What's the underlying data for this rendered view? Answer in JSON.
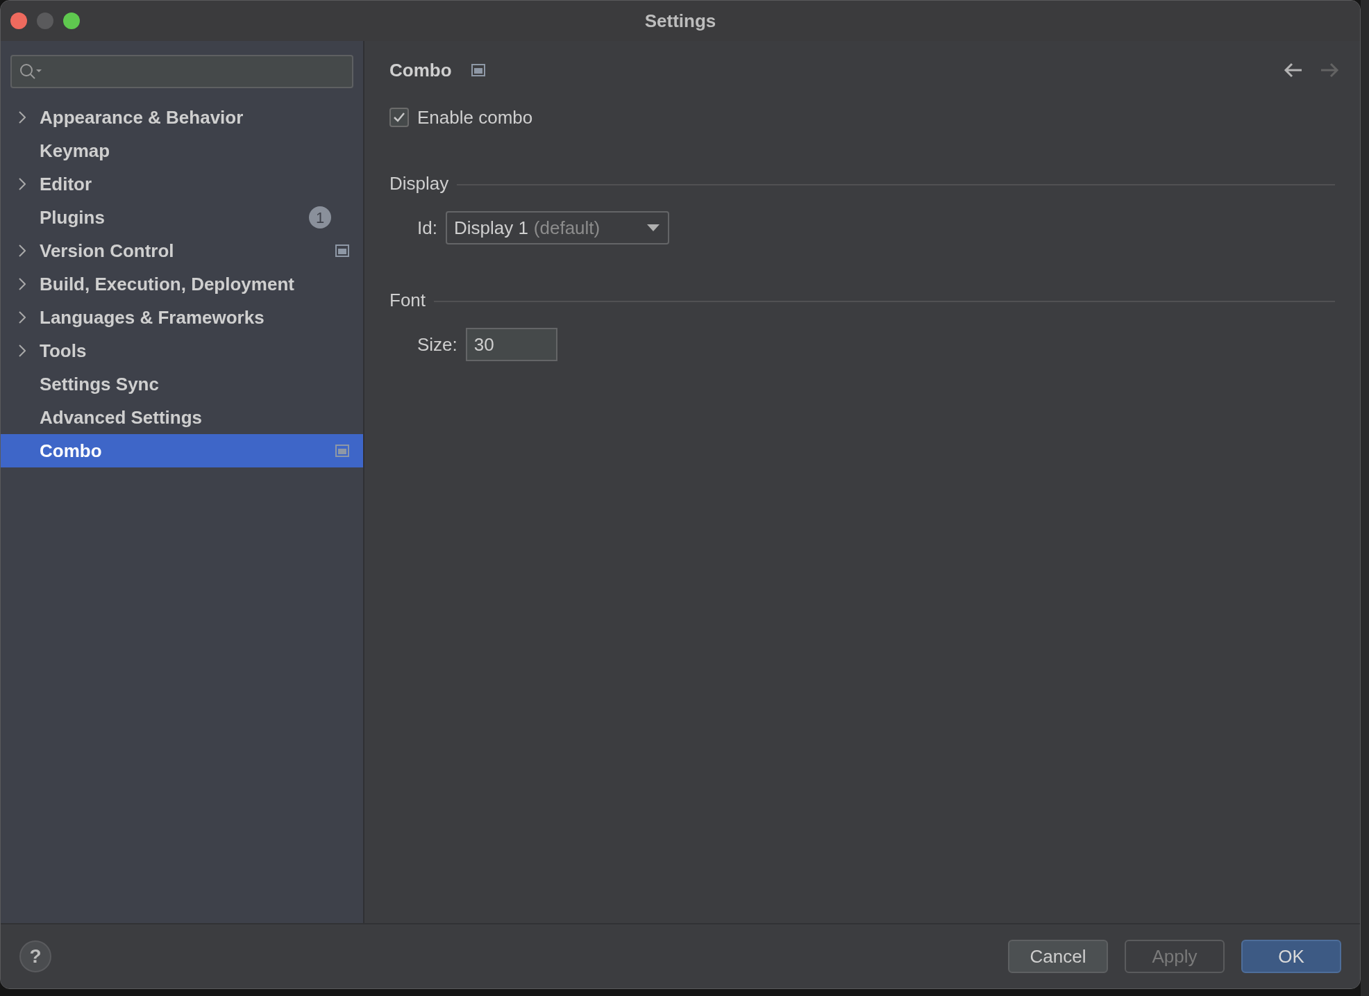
{
  "window": {
    "title": "Settings"
  },
  "sidebar": {
    "items": [
      {
        "label": "Appearance & Behavior",
        "expandable": true,
        "selected": false,
        "project_level": false
      },
      {
        "label": "Keymap",
        "expandable": false,
        "selected": false,
        "project_level": false
      },
      {
        "label": "Editor",
        "expandable": true,
        "selected": false,
        "project_level": false
      },
      {
        "label": "Plugins",
        "expandable": false,
        "selected": false,
        "project_level": false,
        "badge": "1"
      },
      {
        "label": "Version Control",
        "expandable": true,
        "selected": false,
        "project_level": true
      },
      {
        "label": "Build, Execution, Deployment",
        "expandable": true,
        "selected": false,
        "project_level": false
      },
      {
        "label": "Languages & Frameworks",
        "expandable": true,
        "selected": false,
        "project_level": false
      },
      {
        "label": "Tools",
        "expandable": true,
        "selected": false,
        "project_level": false
      },
      {
        "label": "Settings Sync",
        "expandable": false,
        "selected": false,
        "project_level": false
      },
      {
        "label": "Advanced Settings",
        "expandable": false,
        "selected": false,
        "project_level": false
      },
      {
        "label": "Combo",
        "expandable": false,
        "selected": true,
        "project_level": true
      }
    ]
  },
  "content": {
    "title": "Combo",
    "project_level": true,
    "enable": {
      "label": "Enable combo",
      "checked": true
    },
    "sections": [
      {
        "title": "Display",
        "field": {
          "kind": "dropdown",
          "label": "Id:",
          "value": "Display 1",
          "hint": "(default)"
        }
      },
      {
        "title": "Font",
        "field": {
          "kind": "text",
          "label": "Size:",
          "value": "30"
        }
      }
    ]
  },
  "help": {
    "label": "?"
  },
  "buttons": [
    {
      "label": "Cancel",
      "kind": "default"
    },
    {
      "label": "Apply",
      "kind": "disabled"
    },
    {
      "label": "OK",
      "kind": "primary"
    }
  ]
}
